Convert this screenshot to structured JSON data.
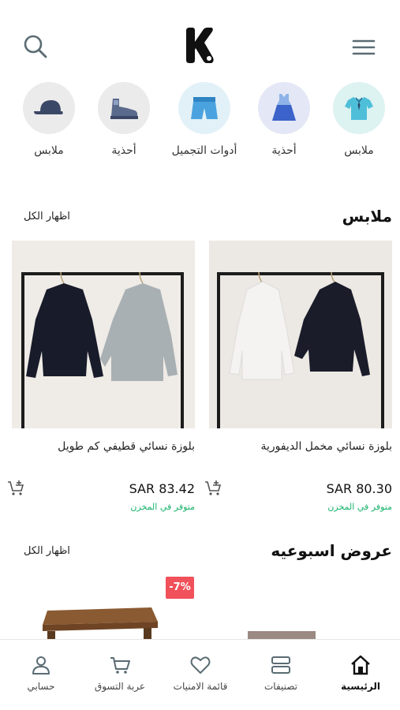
{
  "header": {
    "logo_letter": "K",
    "icons": {
      "search": "search-icon",
      "menu": "hamburger-menu-icon"
    }
  },
  "categories": [
    {
      "label": "ملابس",
      "icon": "shirt-icon",
      "bg": "#ddf3f1"
    },
    {
      "label": "أحذية",
      "icon": "dress-icon",
      "bg": "#e4e8f6"
    },
    {
      "label": "أدوات التجميل",
      "icon": "shorts-icon",
      "bg": "#e2f1f8"
    },
    {
      "label": "أحذية",
      "icon": "sneaker-icon",
      "bg": "#ebebeb"
    },
    {
      "label": "ملابس",
      "icon": "cap-icon",
      "bg": "#ebebeb"
    }
  ],
  "clothes_section": {
    "title": "ملابس",
    "show_all": "اظهار الكل",
    "products": [
      {
        "name": "بلوزة نسائي مخمل الديفورية",
        "price": "SAR 80.30",
        "stock": "متوفر في المخزن"
      },
      {
        "name": "بلوزة نسائي قطيفي كم طويل",
        "price": "SAR 83.42",
        "stock": "متوفر في المخزن"
      }
    ]
  },
  "weekly_section": {
    "title": "عروض اسبوعيه",
    "show_all": "اظهار الكل",
    "discount_badge": "-7%"
  },
  "tabbar": {
    "items": [
      {
        "label": "الرئيسية",
        "icon": "home-icon",
        "active": true
      },
      {
        "label": "تصنيفات",
        "icon": "categories-icon",
        "active": false
      },
      {
        "label": "قائمة الامنيات",
        "icon": "heart-icon",
        "active": false
      },
      {
        "label": "عربة التسوق",
        "icon": "cart-icon",
        "active": false
      },
      {
        "label": "حسابي",
        "icon": "user-icon",
        "active": false
      }
    ]
  },
  "colors": {
    "accent": "#19b36b",
    "discount": "#f0515a",
    "icon_gray": "#5a6b73"
  }
}
